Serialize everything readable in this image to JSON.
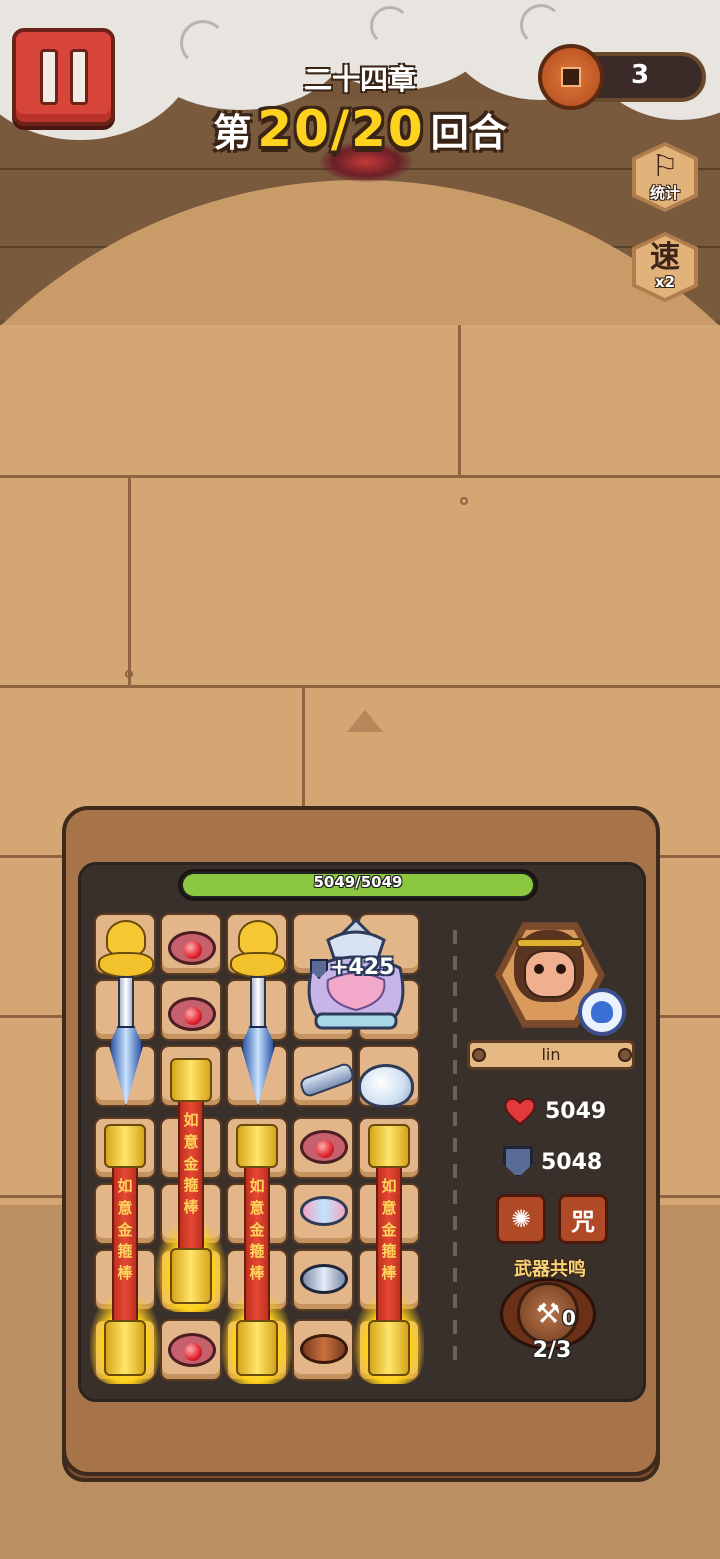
{
  "hud": {
    "chapter": "二十四章",
    "round_prefix": "第",
    "round_value": "20/20",
    "round_suffix": "回合",
    "coins": "3",
    "stats_button": {
      "glyph": "⚐",
      "label": "统计"
    },
    "speed_button": {
      "glyph": "速",
      "label": "x2"
    }
  },
  "board": {
    "hp_text": "5049/5049",
    "hp_fraction": 1.0,
    "armor_bonus": "+425",
    "staff_text": [
      "如",
      "意",
      "金",
      "箍",
      "棒"
    ]
  },
  "hero": {
    "name": "lin",
    "health": "5049",
    "armor": "5048",
    "skills": [
      {
        "glyph": "✺",
        "icon": "rage-face-icon"
      },
      {
        "glyph": "咒",
        "icon": "curse-glyph-icon"
      }
    ]
  },
  "resonance": {
    "title": "武器共鸣",
    "count": "0",
    "progress": "2/3"
  },
  "colors": {
    "hp_green": "#8bc83f",
    "round_yellow": "#ffd21f",
    "pause_red": "#d8453a",
    "board_dark": "#3a302b"
  },
  "icons": {
    "pause": "pause-icon",
    "coin": "square-hole-coin-icon",
    "heart": "heart-icon",
    "shield": "shield-icon",
    "resonance": "weapon-resonance-icon"
  }
}
